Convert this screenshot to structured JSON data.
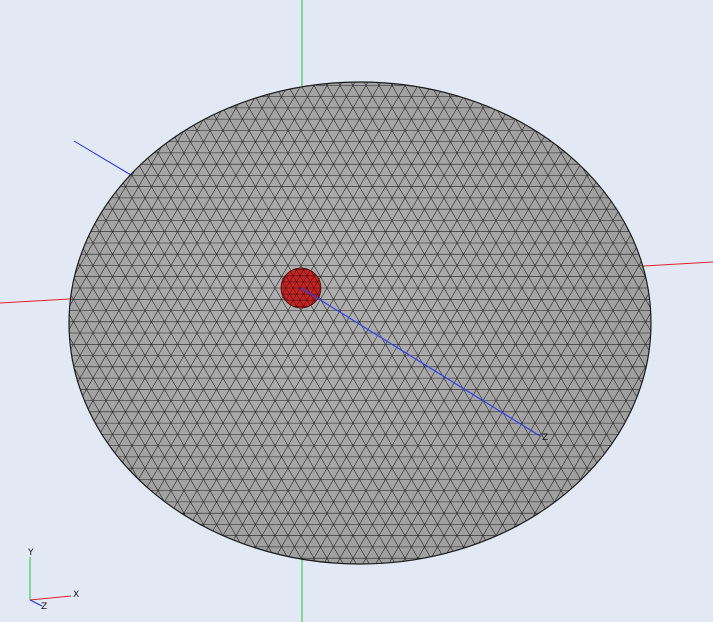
{
  "viewport": {
    "background": "#e3e9f4",
    "axis_colors": {
      "x": "#e0202a",
      "y": "#1ec83c",
      "z": "#2030e0"
    }
  },
  "mesh": {
    "element_type": "triangular surface mesh",
    "face_color": "#a7a7a7",
    "edge_color": "#202020",
    "highlight_color": "#c42424"
  },
  "triad": {
    "x_label": "X",
    "y_label": "Y",
    "z_label": "Z"
  },
  "z_axis_end_label": "Z"
}
